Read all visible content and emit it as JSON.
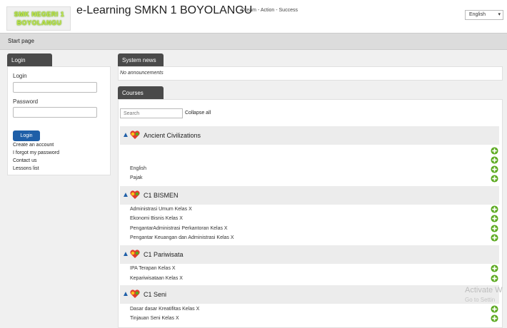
{
  "header": {
    "logo_line1": "SMK NEGERI 1",
    "logo_line2": "BOYOLANGU",
    "site_title": "e-Learning SMKN 1 BOYOLANGU",
    "tagline": "Dream - Action - Success",
    "language": "English"
  },
  "nav": {
    "breadcrumb": "Start page"
  },
  "login": {
    "tab": "Login",
    "username_label": "Login",
    "password_label": "Password",
    "button": "Login",
    "links": [
      "Create an account",
      "I forgot my password",
      "Contact us",
      "Lessons list"
    ]
  },
  "news": {
    "tab": "System news",
    "text": "No announcements"
  },
  "courses": {
    "tab": "Courses",
    "search_placeholder": "Search",
    "collapse_label": "Collapse all",
    "categories": [
      {
        "name": "Ancient Civilizations",
        "items": [
          "",
          "",
          "English",
          "Pajak"
        ]
      },
      {
        "name": "C1 BISMEN",
        "items": [
          "Administrasi Umum Kelas X",
          "Ekonomi Bisnis Kelas X",
          "PengantarAdministrasi Perkantoran Kelas X",
          "Pengantar Keuangan dan Administrasi Kelas X"
        ]
      },
      {
        "name": "C1 Pariwisata",
        "items": [
          "IPA Terapan Kelas X",
          "Kepariwisataan Kelas X"
        ]
      },
      {
        "name": "C1 Seni",
        "items": [
          "Dasar dasar Kreatifitas Kelas X",
          "Tinjauan Seni Kelas X"
        ]
      }
    ]
  },
  "watermark": {
    "line1": "Activate W",
    "line2": "Go to Settin"
  },
  "colors": {
    "tab_bg": "#4a4a4a",
    "button_blue": "#1f5fa8",
    "plus_green": "#5aa91e"
  },
  "icons": {
    "category": "course-category-icon",
    "expand": "caret-up-icon",
    "enrol": "plus-circle-icon"
  }
}
